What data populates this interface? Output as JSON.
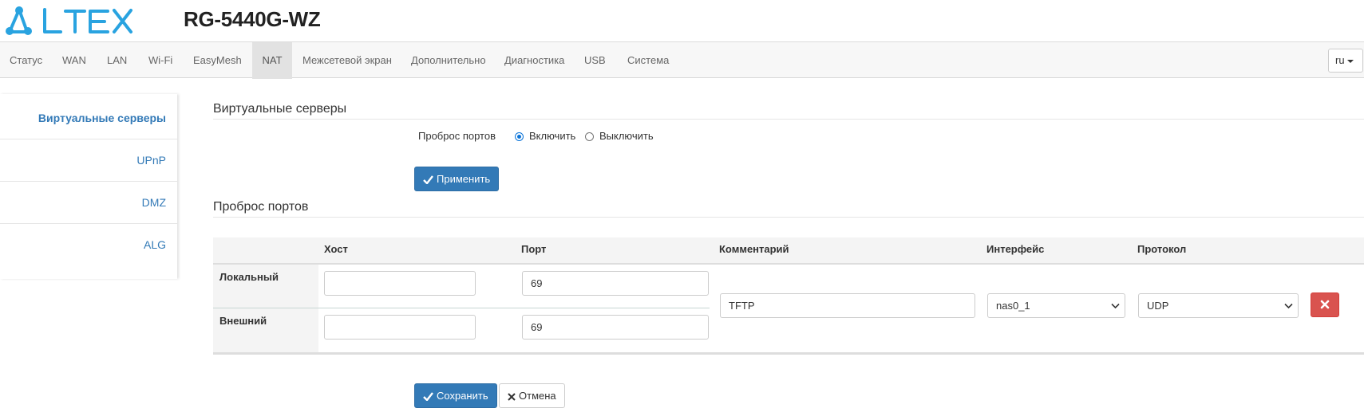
{
  "brand": {
    "logo_text": "ELTEX",
    "model": "RG-5440G-WZ"
  },
  "nav": {
    "items": [
      {
        "label": "Статус"
      },
      {
        "label": "WAN"
      },
      {
        "label": "LAN"
      },
      {
        "label": "Wi-Fi"
      },
      {
        "label": "EasyMesh"
      },
      {
        "label": "NAT",
        "active": true
      },
      {
        "label": "Межсетевой экран"
      },
      {
        "label": "Дополнительно"
      },
      {
        "label": "Диагностика"
      },
      {
        "label": "USB"
      },
      {
        "label": "Система"
      }
    ],
    "language": "ru"
  },
  "sidebar": {
    "items": [
      {
        "label": "Виртуальные серверы",
        "active": true
      },
      {
        "label": "UPnP"
      },
      {
        "label": "DMZ"
      },
      {
        "label": "ALG"
      }
    ]
  },
  "virtual_servers": {
    "title": "Виртуальные серверы",
    "port_forwarding_label": "Проброс портов",
    "enable_label": "Включить",
    "disable_label": "Выключить",
    "selected": "enable",
    "apply_label": "Применить"
  },
  "port_forwarding": {
    "title": "Проброс портов",
    "headers": {
      "host": "Хост",
      "port": "Порт",
      "comment": "Комментарий",
      "interface": "Интерфейс",
      "protocol": "Протокол"
    },
    "rows": {
      "local": {
        "label": "Локальный",
        "host": "",
        "port": "69"
      },
      "external": {
        "label": "Внешний",
        "host": "",
        "port": "69"
      }
    },
    "comment": "TFTP",
    "interface": "nas0_1",
    "protocol": "UDP",
    "delete_icon": "close-icon"
  },
  "actions": {
    "save_label": "Сохранить",
    "cancel_label": "Отмена"
  },
  "colors": {
    "primary": "#337ab7",
    "danger": "#d9534f",
    "logo": "#29a3e0"
  }
}
